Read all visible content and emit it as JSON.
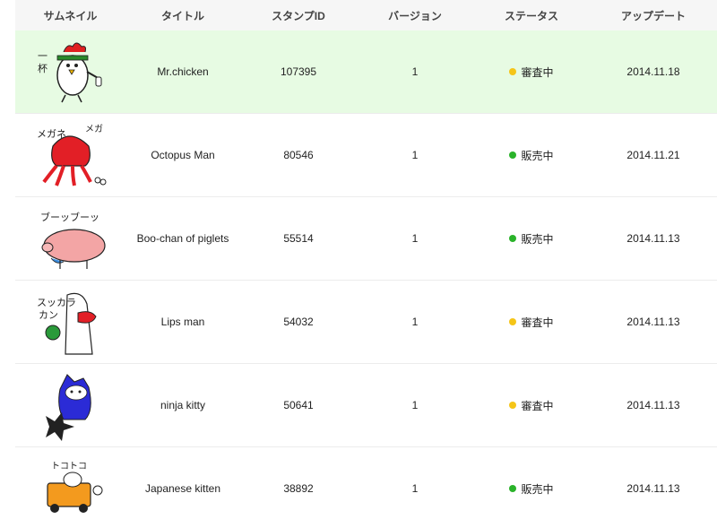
{
  "columns": [
    "サムネイル",
    "タイトル",
    "スタンプID",
    "バージョン",
    "ステータス",
    "アップデート"
  ],
  "status_colors": {
    "審査中": "#f5c518",
    "販売中": "#2ab32a"
  },
  "rows": [
    {
      "thumbnail": "chicken-sticker-icon",
      "title": "Mr.chicken",
      "id": "107395",
      "version": "1",
      "status": "審査中",
      "updated": "2014.11.18",
      "highlight": true
    },
    {
      "thumbnail": "octopus-sticker-icon",
      "title": "Octopus Man",
      "id": "80546",
      "version": "1",
      "status": "販売中",
      "updated": "2014.11.21",
      "highlight": false
    },
    {
      "thumbnail": "piglet-sticker-icon",
      "title": "Boo-chan of piglets",
      "id": "55514",
      "version": "1",
      "status": "販売中",
      "updated": "2014.11.13",
      "highlight": false
    },
    {
      "thumbnail": "lips-man-sticker-icon",
      "title": "Lips man",
      "id": "54032",
      "version": "1",
      "status": "審査中",
      "updated": "2014.11.13",
      "highlight": false
    },
    {
      "thumbnail": "ninja-kitty-sticker-icon",
      "title": "ninja kitty",
      "id": "50641",
      "version": "1",
      "status": "審査中",
      "updated": "2014.11.13",
      "highlight": false
    },
    {
      "thumbnail": "kitten-car-sticker-icon",
      "title": "Japanese kitten",
      "id": "38892",
      "version": "1",
      "status": "販売中",
      "updated": "2014.11.13",
      "highlight": false
    }
  ]
}
